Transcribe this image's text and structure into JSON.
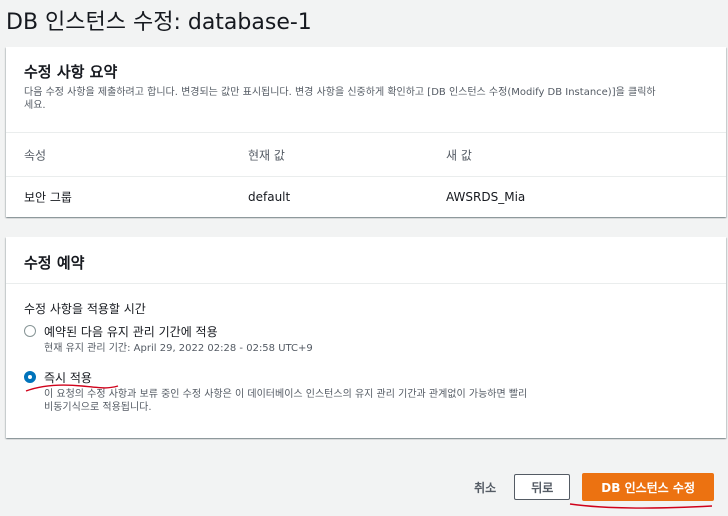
{
  "page": {
    "title": "DB 인스턴스 수정: database-1"
  },
  "summary": {
    "title": "수정 사항 요약",
    "description": "다음 수정 사항을 제출하려고 합니다. 변경되는 값만 표시됩니다. 변경 사항을 신중하게 확인하고 [DB 인스턴스 수정(Modify DB Instance)]을 클릭하세요.",
    "columns": [
      "속성",
      "현재 값",
      "새 값"
    ],
    "rows": [
      {
        "attribute": "보안 그룹",
        "current": "default",
        "new": "AWSRDS_Mia"
      }
    ]
  },
  "schedule": {
    "title": "수정 예약",
    "field_label": "수정 사항을 적용할 시간",
    "options": [
      {
        "label": "예약된 다음 유지 관리 기간에 적용",
        "description": "현재 유지 관리 기간: April 29, 2022 02:28 - 02:58 UTC+9",
        "checked": false
      },
      {
        "label": "즉시 적용",
        "description": "이 요청의 수정 사항과 보류 중인 수정 사항은 이 데이터베이스 인스턴스의 유지 관리 기간과 관계없이 가능하면 빨리 비동기식으로 적용됩니다.",
        "checked": true
      }
    ]
  },
  "footer": {
    "cancel_label": "취소",
    "back_label": "뒤로",
    "submit_label": "DB 인스턴스 수정"
  },
  "colors": {
    "primary": "#ec7211",
    "radio_selected": "#0073bb",
    "annotation": "#d0021b"
  }
}
